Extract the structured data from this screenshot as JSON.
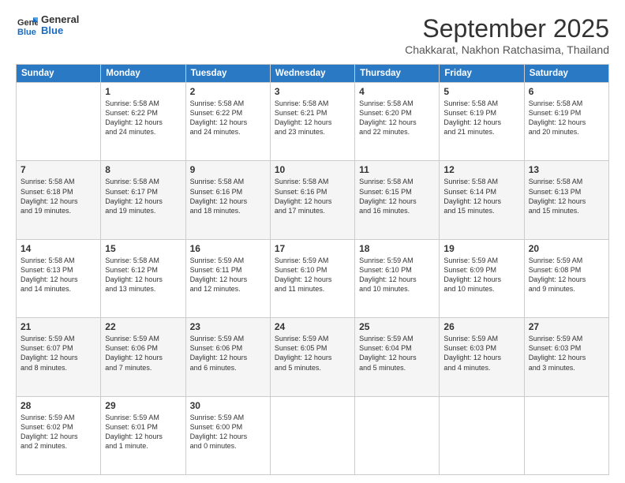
{
  "header": {
    "logo_general": "General",
    "logo_blue": "Blue",
    "month_title": "September 2025",
    "subtitle": "Chakkarat, Nakhon Ratchasima, Thailand"
  },
  "days_of_week": [
    "Sunday",
    "Monday",
    "Tuesday",
    "Wednesday",
    "Thursday",
    "Friday",
    "Saturday"
  ],
  "weeks": [
    [
      {
        "day": "",
        "info": ""
      },
      {
        "day": "1",
        "info": "Sunrise: 5:58 AM\nSunset: 6:22 PM\nDaylight: 12 hours\nand 24 minutes."
      },
      {
        "day": "2",
        "info": "Sunrise: 5:58 AM\nSunset: 6:22 PM\nDaylight: 12 hours\nand 24 minutes."
      },
      {
        "day": "3",
        "info": "Sunrise: 5:58 AM\nSunset: 6:21 PM\nDaylight: 12 hours\nand 23 minutes."
      },
      {
        "day": "4",
        "info": "Sunrise: 5:58 AM\nSunset: 6:20 PM\nDaylight: 12 hours\nand 22 minutes."
      },
      {
        "day": "5",
        "info": "Sunrise: 5:58 AM\nSunset: 6:19 PM\nDaylight: 12 hours\nand 21 minutes."
      },
      {
        "day": "6",
        "info": "Sunrise: 5:58 AM\nSunset: 6:19 PM\nDaylight: 12 hours\nand 20 minutes."
      }
    ],
    [
      {
        "day": "7",
        "info": "Sunrise: 5:58 AM\nSunset: 6:18 PM\nDaylight: 12 hours\nand 19 minutes."
      },
      {
        "day": "8",
        "info": "Sunrise: 5:58 AM\nSunset: 6:17 PM\nDaylight: 12 hours\nand 19 minutes."
      },
      {
        "day": "9",
        "info": "Sunrise: 5:58 AM\nSunset: 6:16 PM\nDaylight: 12 hours\nand 18 minutes."
      },
      {
        "day": "10",
        "info": "Sunrise: 5:58 AM\nSunset: 6:16 PM\nDaylight: 12 hours\nand 17 minutes."
      },
      {
        "day": "11",
        "info": "Sunrise: 5:58 AM\nSunset: 6:15 PM\nDaylight: 12 hours\nand 16 minutes."
      },
      {
        "day": "12",
        "info": "Sunrise: 5:58 AM\nSunset: 6:14 PM\nDaylight: 12 hours\nand 15 minutes."
      },
      {
        "day": "13",
        "info": "Sunrise: 5:58 AM\nSunset: 6:13 PM\nDaylight: 12 hours\nand 15 minutes."
      }
    ],
    [
      {
        "day": "14",
        "info": "Sunrise: 5:58 AM\nSunset: 6:13 PM\nDaylight: 12 hours\nand 14 minutes."
      },
      {
        "day": "15",
        "info": "Sunrise: 5:58 AM\nSunset: 6:12 PM\nDaylight: 12 hours\nand 13 minutes."
      },
      {
        "day": "16",
        "info": "Sunrise: 5:59 AM\nSunset: 6:11 PM\nDaylight: 12 hours\nand 12 minutes."
      },
      {
        "day": "17",
        "info": "Sunrise: 5:59 AM\nSunset: 6:10 PM\nDaylight: 12 hours\nand 11 minutes."
      },
      {
        "day": "18",
        "info": "Sunrise: 5:59 AM\nSunset: 6:10 PM\nDaylight: 12 hours\nand 10 minutes."
      },
      {
        "day": "19",
        "info": "Sunrise: 5:59 AM\nSunset: 6:09 PM\nDaylight: 12 hours\nand 10 minutes."
      },
      {
        "day": "20",
        "info": "Sunrise: 5:59 AM\nSunset: 6:08 PM\nDaylight: 12 hours\nand 9 minutes."
      }
    ],
    [
      {
        "day": "21",
        "info": "Sunrise: 5:59 AM\nSunset: 6:07 PM\nDaylight: 12 hours\nand 8 minutes."
      },
      {
        "day": "22",
        "info": "Sunrise: 5:59 AM\nSunset: 6:06 PM\nDaylight: 12 hours\nand 7 minutes."
      },
      {
        "day": "23",
        "info": "Sunrise: 5:59 AM\nSunset: 6:06 PM\nDaylight: 12 hours\nand 6 minutes."
      },
      {
        "day": "24",
        "info": "Sunrise: 5:59 AM\nSunset: 6:05 PM\nDaylight: 12 hours\nand 5 minutes."
      },
      {
        "day": "25",
        "info": "Sunrise: 5:59 AM\nSunset: 6:04 PM\nDaylight: 12 hours\nand 5 minutes."
      },
      {
        "day": "26",
        "info": "Sunrise: 5:59 AM\nSunset: 6:03 PM\nDaylight: 12 hours\nand 4 minutes."
      },
      {
        "day": "27",
        "info": "Sunrise: 5:59 AM\nSunset: 6:03 PM\nDaylight: 12 hours\nand 3 minutes."
      }
    ],
    [
      {
        "day": "28",
        "info": "Sunrise: 5:59 AM\nSunset: 6:02 PM\nDaylight: 12 hours\nand 2 minutes."
      },
      {
        "day": "29",
        "info": "Sunrise: 5:59 AM\nSunset: 6:01 PM\nDaylight: 12 hours\nand 1 minute."
      },
      {
        "day": "30",
        "info": "Sunrise: 5:59 AM\nSunset: 6:00 PM\nDaylight: 12 hours\nand 0 minutes."
      },
      {
        "day": "",
        "info": ""
      },
      {
        "day": "",
        "info": ""
      },
      {
        "day": "",
        "info": ""
      },
      {
        "day": "",
        "info": ""
      }
    ]
  ]
}
